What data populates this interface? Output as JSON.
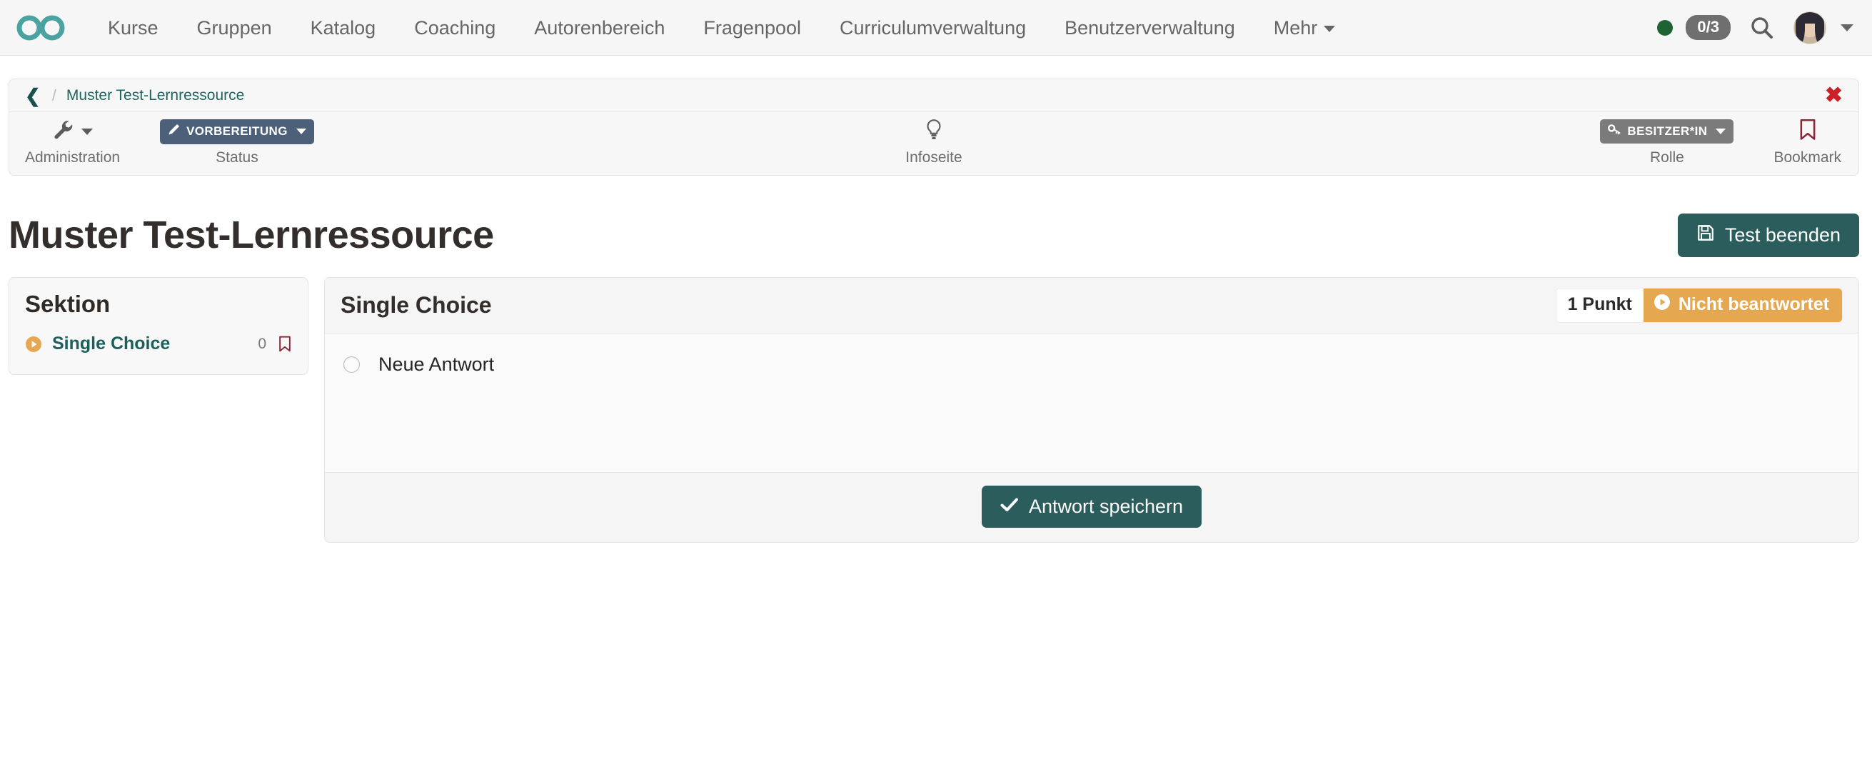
{
  "navbar": {
    "brand_icon": "infinity-logo",
    "brand_color": "#4aa3a0",
    "items": [
      {
        "label": "Kurse",
        "name": "nav-kurse"
      },
      {
        "label": "Gruppen",
        "name": "nav-gruppen"
      },
      {
        "label": "Katalog",
        "name": "nav-katalog"
      },
      {
        "label": "Coaching",
        "name": "nav-coaching"
      },
      {
        "label": "Autorenbereich",
        "name": "nav-autorenbereich"
      },
      {
        "label": "Fragenpool",
        "name": "nav-fragenpool"
      },
      {
        "label": "Curriculumverwaltung",
        "name": "nav-curriculumverwaltung"
      },
      {
        "label": "Benutzerverwaltung",
        "name": "nav-benutzerverwaltung"
      },
      {
        "label": "Mehr",
        "name": "nav-mehr",
        "has_caret": true
      }
    ],
    "status_dot_color": "#1d6333",
    "task_count": "0/3",
    "search_icon": "search-icon",
    "avatar_icon": "user-avatar",
    "user_caret_icon": "chevron-down-icon"
  },
  "toolbar": {
    "back_icon": "chevron-left-icon",
    "separator": "/",
    "breadcrumb": "Muster Test-Lernressource",
    "close_icon": "close-icon",
    "close_glyph": "✖",
    "tools": [
      {
        "label": "Administration",
        "icon": "wrench-icon"
      },
      {
        "label": "Status",
        "icon": "pencil-icon",
        "pill": "VORBEREITUNG",
        "pill_color": "#4c6179"
      },
      {
        "label": "Infoseite",
        "icon": "lightbulb-icon"
      },
      {
        "label": "Rolle",
        "icon": "key-icon",
        "pill": "BESITZER*IN",
        "pill_color": "#7b7b7b"
      },
      {
        "label": "Bookmark",
        "icon": "bookmark-icon"
      }
    ]
  },
  "page": {
    "title": "Muster Test-Lernressource",
    "end_test_button": "Test beenden",
    "end_test_icon": "save-icon",
    "accent_color": "#2a5d5c"
  },
  "sidebar": {
    "title": "Sektion",
    "items": [
      {
        "label": "Single Choice",
        "count": "0",
        "status_icon": "play-circle-icon",
        "status_color": "#e5a851",
        "bookmark_icon": "bookmark-icon"
      }
    ]
  },
  "question": {
    "title": "Single Choice",
    "points_badge": "1 Punkt",
    "state_badge": "Nicht beantwortet",
    "state_icon": "play-circle-icon",
    "state_color": "#e5a851",
    "answers": [
      {
        "label": "Neue Antwort",
        "selected": false,
        "input_type": "radio"
      }
    ],
    "save_button": "Antwort speichern",
    "save_icon": "check-icon"
  }
}
